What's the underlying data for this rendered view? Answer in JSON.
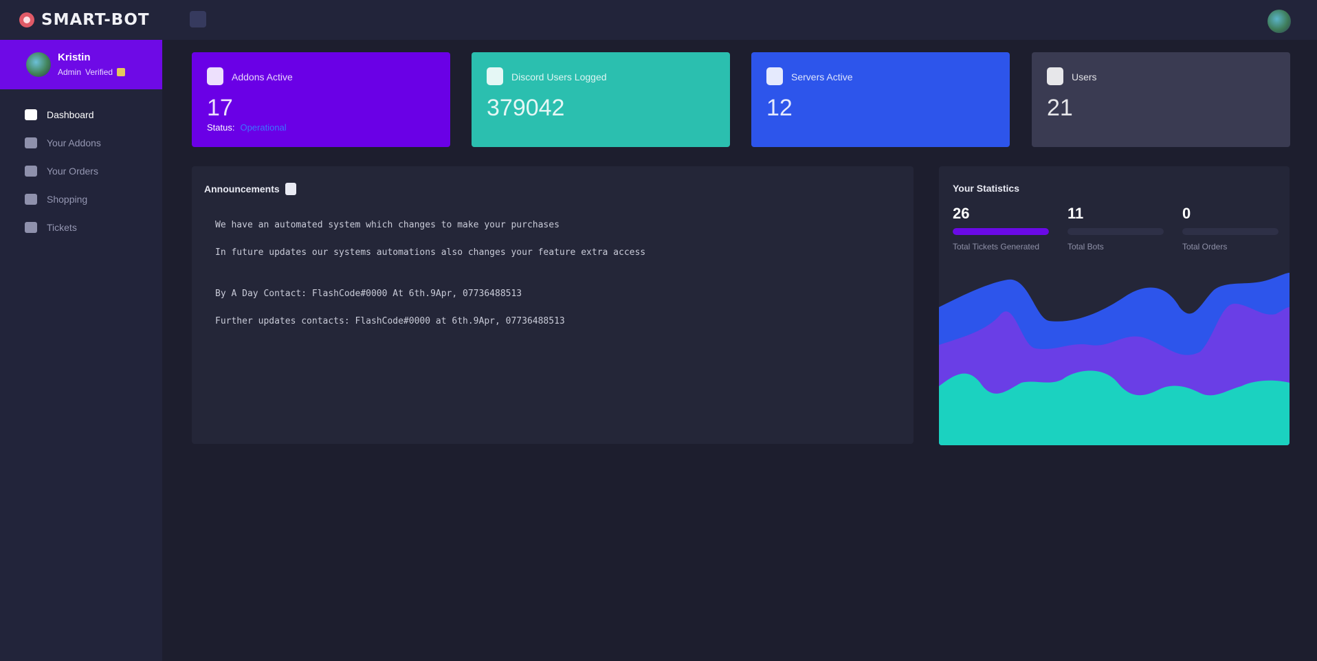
{
  "header": {
    "brand": "SMART-BOT",
    "menu_toggle_icon": "hamburger-icon",
    "avatar_icon": "user-avatar-icon"
  },
  "sidebar": {
    "user": {
      "name": "Kristin",
      "role": "Admin",
      "status": "Verified"
    },
    "items": [
      {
        "label": "Dashboard",
        "icon": "home-icon",
        "active": true
      },
      {
        "label": "Your Addons",
        "icon": "puzzle-icon",
        "active": false
      },
      {
        "label": "Your Orders",
        "icon": "cart-icon",
        "active": false
      },
      {
        "label": "Shopping",
        "icon": "bag-icon",
        "active": false
      },
      {
        "label": "Tickets",
        "icon": "ticket-icon",
        "active": false
      }
    ]
  },
  "cards": [
    {
      "label": "Addons Active",
      "value": "17",
      "sub_label": "Status:",
      "sub_link": "Operational",
      "icon": "addon-icon",
      "color": "#6a00e6"
    },
    {
      "label": "Discord Users Logged",
      "value": "379042",
      "icon": "discord-icon",
      "color": "#2bbfaf"
    },
    {
      "label": "Servers Active",
      "value": "12",
      "icon": "server-icon",
      "color": "#2d55eb"
    },
    {
      "label": "Users",
      "value": "21",
      "icon": "user-icon",
      "color": "#3a3b52"
    }
  ],
  "announcements": {
    "title": "Announcements",
    "lines": [
      "We have an automated system which changes to make your purchases",
      "In future updates our systems automations also changes your feature extra access",
      "By A Day Contact: FlashCode#0000 At 6th.9Apr, 07736488513",
      "Further updates contacts: FlashCode#0000 at 6th.9Apr, 07736488513"
    ]
  },
  "stats": {
    "title": "Your Statistics",
    "items": [
      {
        "value": "26",
        "caption": "Total Tickets Generated",
        "fill": 1.0
      },
      {
        "value": "11",
        "caption": "Total Bots",
        "fill": 0.0
      },
      {
        "value": "0",
        "caption": "Total Orders",
        "fill": 0.0
      }
    ],
    "colors": [
      "#2d55eb",
      "#6a3ee6",
      "#1bd2c0"
    ]
  }
}
